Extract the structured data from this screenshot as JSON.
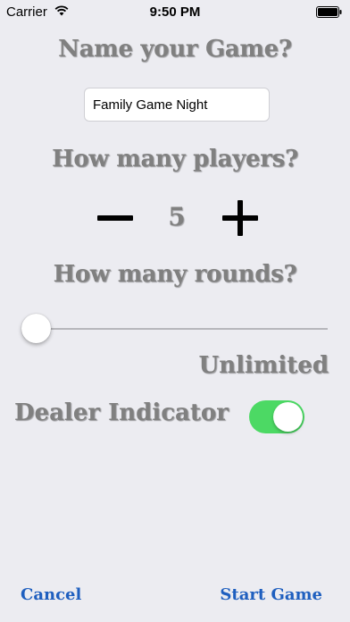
{
  "status_bar": {
    "carrier": "Carrier",
    "time": "9:50 PM",
    "icons": [
      "wifi-icon",
      "battery-icon"
    ]
  },
  "game_name": {
    "heading": "Name your Game?",
    "value": "Family Game Night"
  },
  "players": {
    "heading": "How many players?",
    "count": "5",
    "icons": [
      "minus-icon",
      "plus-icon"
    ]
  },
  "rounds": {
    "heading": "How many rounds?",
    "slider_fraction": 0,
    "value_label": "Unlimited"
  },
  "dealer": {
    "label": "Dealer Indicator",
    "enabled": true
  },
  "footer": {
    "cancel_label": "Cancel",
    "start_label": "Start Game"
  },
  "colors": {
    "background": "#ececf1",
    "heading_text": "#808080",
    "toggle_on": "#4cd964",
    "link": "#1f5fbf"
  }
}
